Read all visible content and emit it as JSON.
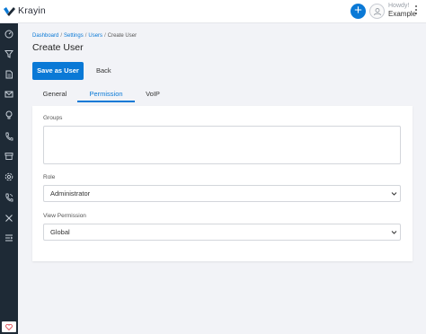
{
  "app": {
    "name": "Krayin"
  },
  "topbar": {
    "add_label": "+",
    "greeting": "Howdy!",
    "user_name": "Example"
  },
  "breadcrumb": {
    "items": [
      "Dashboard",
      "Settings",
      "Users"
    ],
    "separator": "/",
    "current": "Create User"
  },
  "page": {
    "title": "Create User"
  },
  "actions": {
    "save_label": "Save as User",
    "back_label": "Back"
  },
  "tabs": [
    {
      "label": "General",
      "active": false
    },
    {
      "label": "Permission",
      "active": true
    },
    {
      "label": "VoIP",
      "active": false
    }
  ],
  "form": {
    "groups_label": "Groups",
    "role_label": "Role",
    "role_value": "Administrator",
    "view_permission_label": "View Permission",
    "view_permission_value": "Global"
  },
  "sidebar": {
    "icons": [
      "dashboard-icon",
      "leads-icon",
      "quotes-icon",
      "mail-icon",
      "activities-icon",
      "contacts-icon",
      "products-icon",
      "settings-icon",
      "voip-icon",
      "configuration-icon",
      "collapse-icon"
    ]
  },
  "colors": {
    "accent": "#0a79d6",
    "sidebar": "#1e2a36",
    "background": "#f2f3f7"
  }
}
